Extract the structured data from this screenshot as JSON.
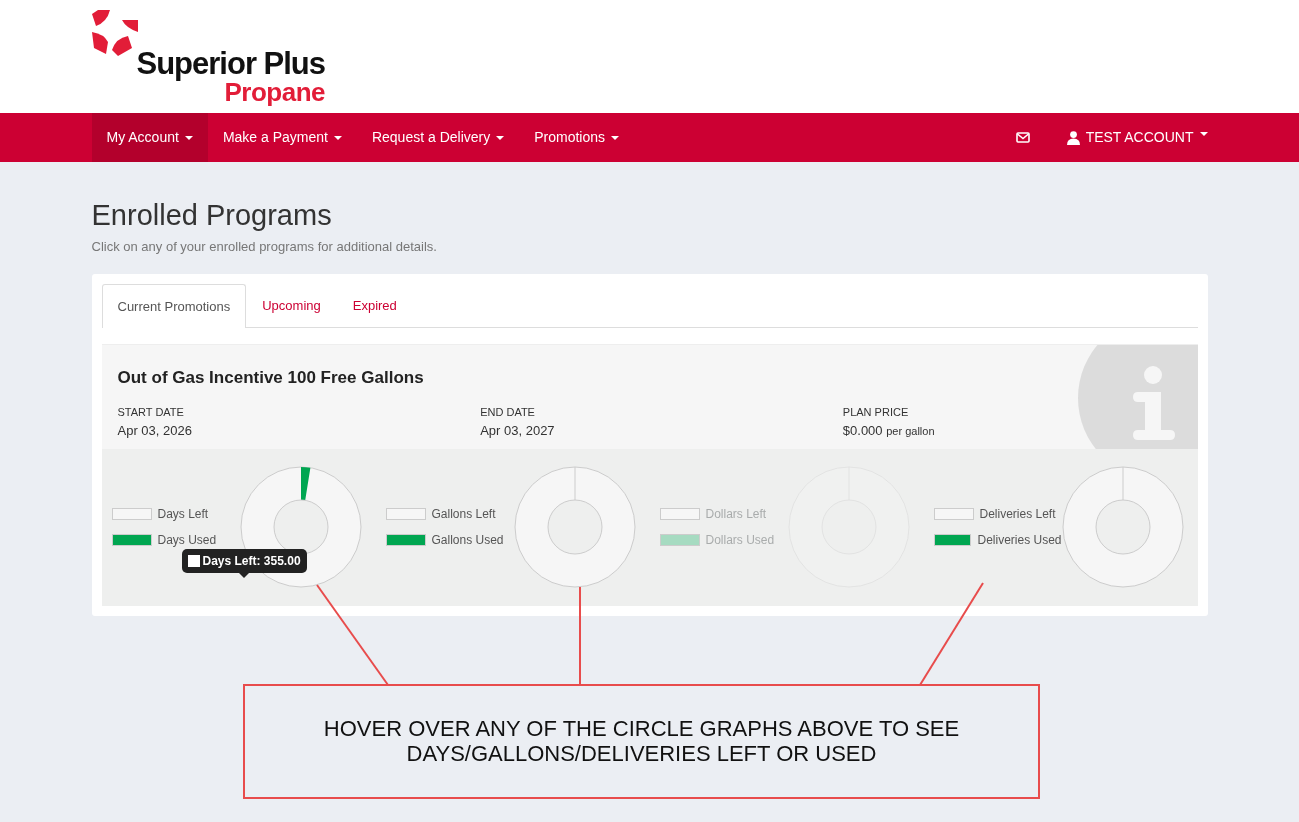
{
  "logo": {
    "line1": "Superior Plus",
    "line2": "Propane"
  },
  "nav": {
    "items": [
      {
        "label": "My Account",
        "selected": true
      },
      {
        "label": "Make a Payment",
        "selected": false
      },
      {
        "label": "Request a Delivery",
        "selected": false
      },
      {
        "label": "Promotions",
        "selected": false
      }
    ],
    "account": "TEST ACCOUNT"
  },
  "page": {
    "title": "Enrolled Programs",
    "subtitle": "Click on any of your enrolled programs for additional details."
  },
  "tabs": [
    {
      "label": "Current Promotions",
      "selected": true
    },
    {
      "label": "Upcoming",
      "selected": false
    },
    {
      "label": "Expired",
      "selected": false
    }
  ],
  "program": {
    "title": "Out of Gas Incentive 100 Free Gallons",
    "fields": [
      {
        "kind": "date",
        "label": "START DATE",
        "value": "Apr 03, 2026"
      },
      {
        "kind": "date",
        "label": "END DATE",
        "value": "Apr 03, 2027"
      },
      {
        "kind": "price",
        "label": "PLAN PRICE",
        "value": "$0.000",
        "unit": "per gallon"
      }
    ],
    "gauges": [
      {
        "legend": [
          {
            "label": "Days Left",
            "color": "#f6f6f6"
          },
          {
            "label": "Days Used",
            "color": "#00a651"
          }
        ],
        "disabled": false,
        "tooltip": "Days Left: 355.00"
      },
      {
        "legend": [
          {
            "label": "Gallons Left",
            "color": "#f6f6f6"
          },
          {
            "label": "Gallons Used",
            "color": "#00a651"
          }
        ],
        "disabled": false
      },
      {
        "legend": [
          {
            "label": "Dollars Left",
            "color": "#f6f6f6"
          },
          {
            "label": "Dollars Used",
            "color": "#a6dbc1"
          }
        ],
        "disabled": true
      },
      {
        "legend": [
          {
            "label": "Deliveries Left",
            "color": "#f6f6f6"
          },
          {
            "label": "Deliveries Used",
            "color": "#00a651"
          }
        ],
        "disabled": false
      }
    ]
  },
  "callout": {
    "lines": [
      "HOVER OVER ANY OF THE CIRCLE GRAPHS ABOVE TO SEE",
      "DAYS/GALLONS/DELIVERIES LEFT OR USED"
    ]
  }
}
